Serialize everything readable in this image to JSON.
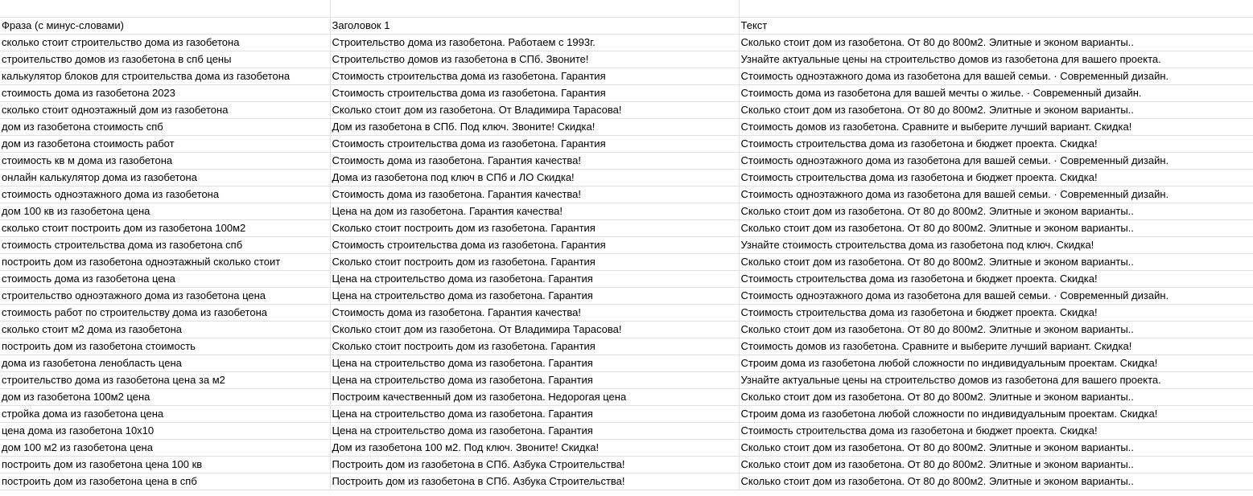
{
  "headers": [
    "Фраза (с минус-словами)",
    "Заголовок 1",
    "Текст"
  ],
  "rows": [
    [
      "сколько стоит строительство дома из газобетона",
      "Строительство дома из газобетона. Работаем с 1993г.",
      "Сколько стоит дом из газобетона. От 80 до 800м2. Элитные и эконом варианты.."
    ],
    [
      "строительство домов из газобетона в спб цены",
      "Строительство домов из газобетона в СПб. Звоните!",
      "Узнайте актуальные цены на строительство домов из газобетона для вашего проекта."
    ],
    [
      "калькулятор блоков для строительства дома из газобетона",
      "Стоимость строительства дома из газобетона. Гарантия",
      "Стоимость одноэтажного дома из газобетона для вашей семьи. · Современный дизайн."
    ],
    [
      "стоимость дома из газобетона 2023",
      "Стоимость строительства дома из газобетона. Гарантия",
      "Стоимость дома из газобетона для вашей мечты о жилье. · Современный дизайн."
    ],
    [
      "сколько стоит одноэтажный дом из газобетона",
      "Сколько стоит дом из газобетона. От Владимира Тарасова!",
      "Сколько стоит дом из газобетона. От 80 до 800м2. Элитные и эконом варианты.."
    ],
    [
      "дом из газобетона стоимость спб",
      "Дом из газобетона в СПб. Под ключ. Звоните! Скидка!",
      "Стоимость домов из газобетона. Сравните и выберите лучший вариант. Скидка!"
    ],
    [
      "дом из газобетона стоимость работ",
      "Стоимость строительства дома из газобетона. Гарантия",
      "Стоимость строительства дома из газобетона и бюджет проекта. Скидка!"
    ],
    [
      "стоимость кв м дома из газобетона",
      "Стоимость дома из газобетона. Гарантия качества!",
      "Стоимость одноэтажного дома из газобетона для вашей семьи. · Современный дизайн."
    ],
    [
      "онлайн калькулятор дома из газобетона",
      "Дома из газобетона под ключ в СПб и ЛО Скидка!",
      "Стоимость строительства дома из газобетона и бюджет проекта. Скидка!"
    ],
    [
      "стоимость одноэтажного дома из газобетона",
      "Стоимость дома из газобетона. Гарантия качества!",
      "Стоимость одноэтажного дома из газобетона для вашей семьи. · Современный дизайн."
    ],
    [
      "дом 100 кв из газобетона цена",
      "Цена на дом из газобетона. Гарантия качества!",
      "Сколько стоит дом из газобетона. От 80 до 800м2. Элитные и эконом варианты.."
    ],
    [
      "сколько стоит построить дом из газобетона 100м2",
      "Сколько стоит построить дом из газобетона. Гарантия",
      "Сколько стоит дом из газобетона. От 80 до 800м2. Элитные и эконом варианты.."
    ],
    [
      "стоимость строительства дома из газобетона спб",
      "Стоимость строительства дома из газобетона. Гарантия",
      "Узнайте стоимость строительства дома из газобетона под ключ. Скидка!"
    ],
    [
      "построить дом из газобетона одноэтажный сколько стоит",
      "Сколько стоит построить дом из газобетона. Гарантия",
      "Сколько стоит дом из газобетона. От 80 до 800м2. Элитные и эконом варианты.."
    ],
    [
      "стоимость дома из газобетона цена",
      "Цена на строительство дома из газобетона. Гарантия",
      "Стоимость строительства дома из газобетона и бюджет проекта. Скидка!"
    ],
    [
      "строительство одноэтажного дома из газобетона цена",
      "Цена на строительство дома из газобетона. Гарантия",
      "Стоимость одноэтажного дома из газобетона для вашей семьи. · Современный дизайн."
    ],
    [
      "стоимость работ по строительству дома из газобетона",
      "Стоимость дома из газобетона. Гарантия качества!",
      "Стоимость строительства дома из газобетона и бюджет проекта. Скидка!"
    ],
    [
      "сколько стоит м2 дома из газобетона",
      "Сколько стоит дом из газобетона. От Владимира Тарасова!",
      "Сколько стоит дом из газобетона. От 80 до 800м2. Элитные и эконом варианты.."
    ],
    [
      "построить дом из газобетона стоимость",
      "Сколько стоит построить дом из газобетона. Гарантия",
      "Стоимость домов из газобетона. Сравните и выберите лучший вариант. Скидка!"
    ],
    [
      "дома из газобетона ленобласть цена",
      "Цена на строительство дома из газобетона. Гарантия",
      "Строим дома из газобетона любой сложности по индивидуальным проектам. Скидка!"
    ],
    [
      "строительство дома из газобетона цена за м2",
      "Цена на строительство дома из газобетона. Гарантия",
      "Узнайте актуальные цены на строительство домов из газобетона для вашего проекта."
    ],
    [
      "дом из газобетона 100м2 цена",
      "Построим качественный дом из газобетона. Недорогая цена",
      "Сколько стоит дом из газобетона. От 80 до 800м2. Элитные и эконом варианты.."
    ],
    [
      "стройка дома из газобетона цена",
      "Цена на строительство дома из газобетона. Гарантия",
      "Строим дома из газобетона любой сложности по индивидуальным проектам. Скидка!"
    ],
    [
      "цена дома из газобетона 10х10",
      "Цена на строительство дома из газобетона. Гарантия",
      "Стоимость строительства дома из газобетона и бюджет проекта. Скидка!"
    ],
    [
      "дом 100 м2 из газобетона цена",
      "Дом из газобетона 100 м2. Под ключ. Звоните! Скидка!",
      "Сколько стоит дом из газобетона. От 80 до 800м2. Элитные и эконом варианты.."
    ],
    [
      "построить дом из газобетона цена 100 кв",
      "Построить дом из газобетона в СПб. Азбука Строительства!",
      "Сколько стоит дом из газобетона. От 80 до 800м2. Элитные и эконом варианты.."
    ],
    [
      "построить дом из газобетона цена в спб",
      "Построить дом из газобетона в СПб. Азбука Строительства!",
      "Сколько стоит дом из газобетона. От 80 до 800м2. Элитные и эконом варианты.."
    ]
  ]
}
